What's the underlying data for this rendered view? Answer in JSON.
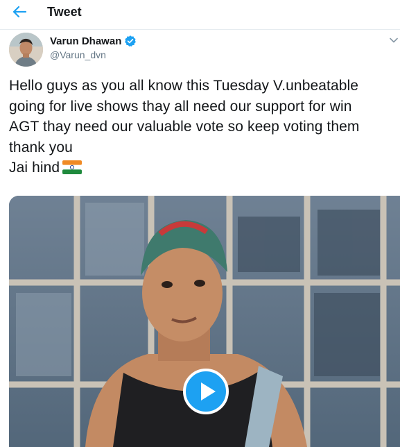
{
  "header": {
    "back_icon": "arrow-left-icon",
    "title": "Tweet",
    "accent_color": "#1da1f2"
  },
  "tweet": {
    "author": {
      "display_name": "Varun Dhawan",
      "handle": "@Varun_dvn",
      "verified": true,
      "verified_icon": "verified-badge-icon"
    },
    "menu_icon": "chevron-down-icon",
    "text_lines": [
      "Hello guys as you all know this Tuesday V.unbeatable",
      "going for live shows thay all need our support for win",
      "AGT thay need our valuable vote so keep voting them",
      "thank you",
      "Jai hind"
    ],
    "emoji": "india-flag-icon",
    "media": {
      "type": "video",
      "play_icon": "play-icon"
    }
  }
}
